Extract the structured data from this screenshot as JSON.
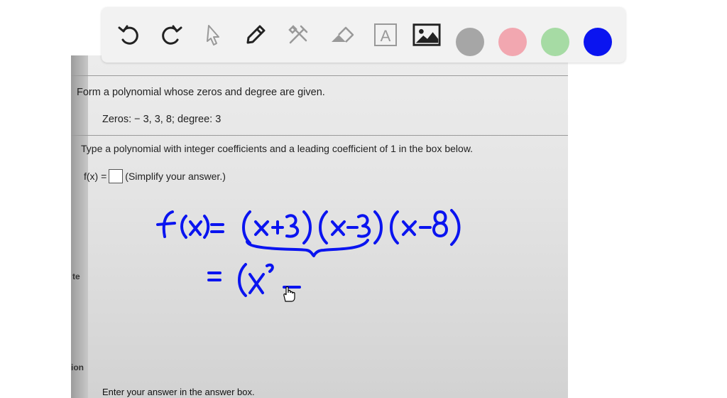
{
  "toolbar": {
    "tools": [
      {
        "name": "undo-icon"
      },
      {
        "name": "redo-icon"
      },
      {
        "name": "select-pointer-icon"
      },
      {
        "name": "pen-icon"
      },
      {
        "name": "tools-icon"
      },
      {
        "name": "eraser-icon"
      },
      {
        "name": "text-icon",
        "label": "A"
      },
      {
        "name": "image-icon"
      }
    ],
    "colors": [
      "#a6a6a6",
      "#f2a7b0",
      "#a6dba4",
      "#0a14f0"
    ],
    "selected_color": "#0a14f0"
  },
  "question": {
    "title": "Form a polynomial whose zeros and degree are given.",
    "zeros_line": "Zeros:  − 3, 3, 8;   degree: 3",
    "instruction": "Type a polynomial with integer coefficients and a leading coefficient of 1 in the box below.",
    "fx_label": "f(x) =",
    "fx_hint": "(Simplify your answer.)",
    "footer": "Enter your answer in the answer box.",
    "edge_fragments": [
      "te",
      "ion"
    ]
  },
  "handwriting": {
    "ink_color": "#0a14f0",
    "line1": "f(x)= (x+3)(x−3)(x−8)",
    "line2": "= (x² −"
  }
}
